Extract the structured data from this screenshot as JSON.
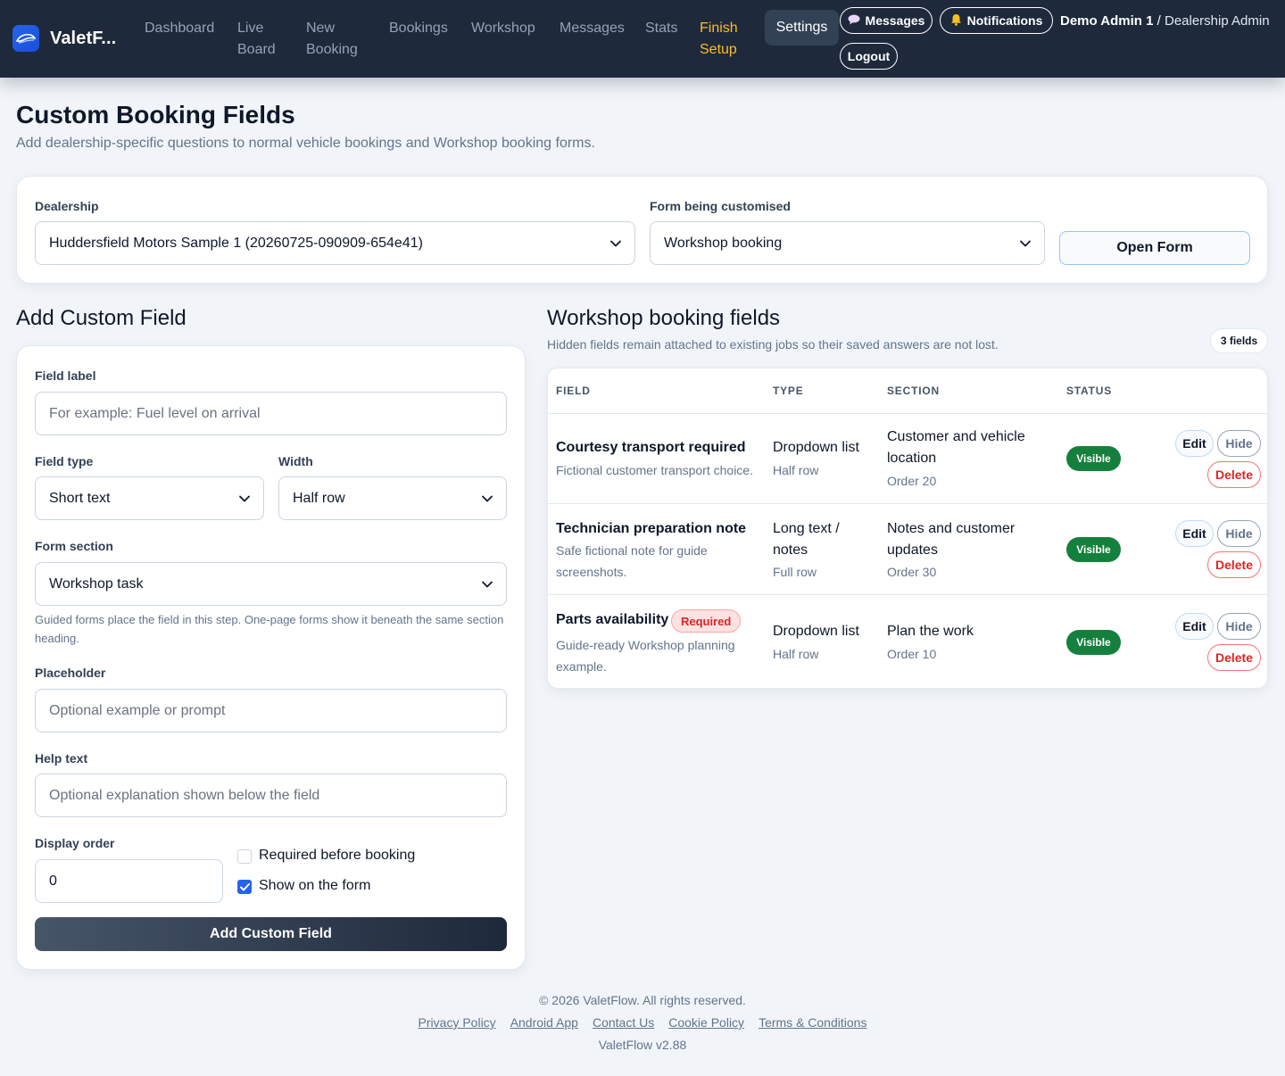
{
  "nav": {
    "brand": "ValetF...",
    "links": [
      {
        "label_1": "Dashboard",
        "label_2": ""
      },
      {
        "label_1": "Live",
        "label_2": "Board"
      },
      {
        "label_1": "New",
        "label_2": "Booking"
      },
      {
        "label_1": "Bookings",
        "label_2": ""
      },
      {
        "label_1": "Workshop",
        "label_2": ""
      },
      {
        "label_1": "Messages",
        "label_2": ""
      },
      {
        "label_1": "Stats",
        "label_2": ""
      },
      {
        "label_1": "Finish",
        "label_2": "Setup"
      }
    ],
    "settings": "Settings",
    "messages_pill": "Messages",
    "notifications_pill": "Notifications",
    "logout": "Logout",
    "user_name": "Demo Admin 1",
    "user_sep": " / ",
    "user_role": "Dealership Admin",
    "accent_color": "#fbbf24"
  },
  "page": {
    "title": "Custom Booking Fields",
    "subtitle": "Add dealership-specific questions to normal vehicle bookings and Workshop booking forms."
  },
  "selector": {
    "dealership_label": "Dealership",
    "dealership_value": "Huddersfield Motors Sample 1 (20260725-090909-654e41)",
    "form_label": "Form being customised",
    "form_value": "Workshop booking",
    "open_button": "Open Form"
  },
  "add_form": {
    "heading": "Add Custom Field",
    "field_label_label": "Field label",
    "field_label_placeholder": "For example: Fuel level on arrival",
    "field_type_label": "Field type",
    "field_type_value": "Short text",
    "width_label": "Width",
    "width_value": "Half row",
    "section_label": "Form section",
    "section_value": "Workshop task",
    "section_hint": "Guided forms place the field in this step. One-page forms show it beneath the same section heading.",
    "placeholder_label": "Placeholder",
    "placeholder_placeholder": "Optional example or prompt",
    "help_label": "Help text",
    "help_placeholder": "Optional explanation shown below the field",
    "order_label": "Display order",
    "order_value": "0",
    "required_label": "Required before booking",
    "required_checked": false,
    "show_label": "Show on the form",
    "show_checked": true,
    "submit": "Add Custom Field"
  },
  "fields_list": {
    "heading": "Workshop booking fields",
    "hint": "Hidden fields remain attached to existing jobs so their saved answers are not lost.",
    "count": "3 fields",
    "columns": [
      "Field",
      "Type",
      "Section",
      "Status"
    ],
    "rows": [
      {
        "name": "Courtesy transport required",
        "required": "",
        "desc_1": "Fictional customer transport choice.",
        "desc_2": "",
        "type_1": "Dropdown list",
        "type_2": "",
        "width": "Half row",
        "section_1": "Customer and vehicle",
        "section_2": "location",
        "order": "Order 20",
        "status": "Visible",
        "edit": "Edit",
        "hide": "Hide",
        "delete": "Delete"
      },
      {
        "name": "Technician preparation note",
        "required": "",
        "desc_1": "Safe fictional note for guide",
        "desc_2": "screenshots.",
        "type_1": "Long text /",
        "type_2": "notes",
        "width": "Full row",
        "section_1": "Notes and customer",
        "section_2": "updates",
        "order": "Order 30",
        "status": "Visible",
        "edit": "Edit",
        "hide": "Hide",
        "delete": "Delete"
      },
      {
        "name": "Parts availability",
        "required": "Required",
        "desc_1": "Guide-ready Workshop planning",
        "desc_2": "example.",
        "type_1": "Dropdown list",
        "type_2": "",
        "width": "Half row",
        "section_1": "Plan the work",
        "section_2": "",
        "order": "Order 10",
        "status": "Visible",
        "edit": "Edit",
        "hide": "Hide",
        "delete": "Delete"
      }
    ]
  },
  "footer": {
    "copyright": "© 2026 ValetFlow. All rights reserved.",
    "links": [
      "Privacy Policy",
      "Android App",
      "Contact Us",
      "Cookie Policy",
      "Terms & Conditions"
    ],
    "version": "ValetFlow v2.88"
  },
  "icons": {
    "brand": "car-logo-icon",
    "messages": "speech-bubble-icon",
    "notifications": "bell-icon",
    "select": "chevron-down-icon",
    "checkbox": "check-icon"
  }
}
